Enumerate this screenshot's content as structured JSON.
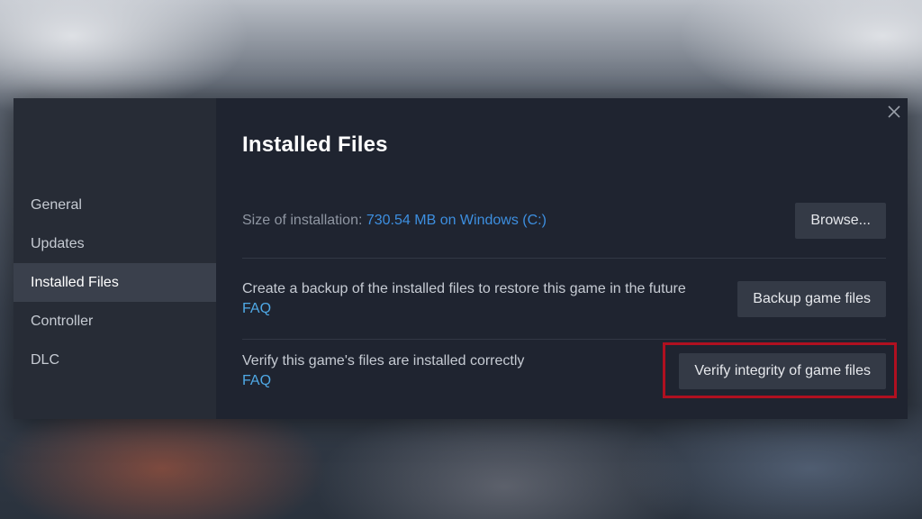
{
  "sidebar": {
    "items": [
      {
        "label": "General"
      },
      {
        "label": "Updates"
      },
      {
        "label": "Installed Files"
      },
      {
        "label": "Controller"
      },
      {
        "label": "DLC"
      }
    ],
    "active": "Installed Files"
  },
  "main": {
    "title": "Installed Files",
    "size_label": "Size of installation: ",
    "size_value": "730.54 MB on Windows (C:)",
    "browse_label": "Browse...",
    "backup_text": "Create a backup of the installed files to restore this game in the future",
    "backup_faq": "FAQ",
    "backup_button": "Backup game files",
    "verify_text": "Verify this game's files are installed correctly",
    "verify_faq": "FAQ",
    "verify_button": "Verify integrity of game files"
  },
  "icons": {
    "close": "close-icon"
  },
  "colors": {
    "accent": "#3d8fe0",
    "link": "#4fa9e6",
    "highlight": "#b01020"
  }
}
